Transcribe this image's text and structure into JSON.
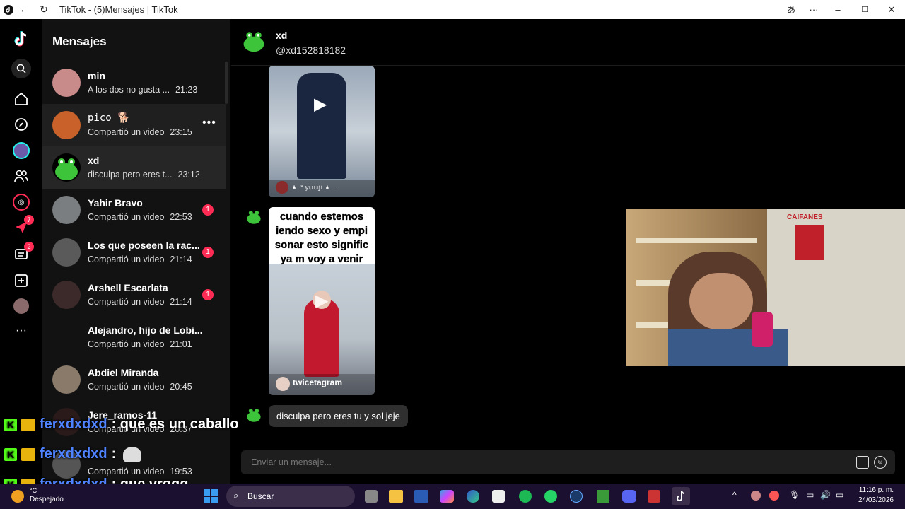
{
  "window": {
    "title": "TikTok - (5)Mensajes | TikTok"
  },
  "sidebar_rail": {
    "badges": {
      "messages_inbox": "7",
      "messages": "2"
    }
  },
  "conversations": {
    "title": "Mensajes",
    "items": [
      {
        "name": "min",
        "preview": "A los dos no gusta ...",
        "time": "21:23",
        "unread": ""
      },
      {
        "name": "𝚙𝚒𝚌𝚘 🐕",
        "preview": "Compartió un video",
        "time": "23:15",
        "unread": ""
      },
      {
        "name": "xd",
        "preview": "disculpa pero eres t...",
        "time": "23:12",
        "unread": ""
      },
      {
        "name": "Yahir Bravo",
        "preview": "Compartió un video",
        "time": "22:53",
        "unread": "1"
      },
      {
        "name": "Los que poseen la rac...",
        "preview": "Compartió un video",
        "time": "21:14",
        "unread": "1"
      },
      {
        "name": "Arshell Escarlata",
        "preview": "Compartió un video",
        "time": "21:14",
        "unread": "1"
      },
      {
        "name": "Alejandro, hijo de Lobi...",
        "preview": "Compartió un video",
        "time": "21:01",
        "unread": ""
      },
      {
        "name": "Abdiel Miranda",
        "preview": "Compartió un video",
        "time": "20:45",
        "unread": ""
      },
      {
        "name": "Jere_ramos-11",
        "preview": "Compartió un video",
        "time": "20:37",
        "unread": ""
      },
      {
        "name": "",
        "preview": "Compartió un video",
        "time": "19:53",
        "unread": ""
      }
    ]
  },
  "chat": {
    "name": "xd",
    "handle": "@xd152818182",
    "video1": {
      "caption": "★. ° 𝕪𝕦𝕦𝕛𝕚 ★. ..."
    },
    "video2": {
      "overlay_text": "cuando estemos\niendo sexo y empi\nsonar esto signific\nya m voy a venir",
      "author": "twicetagram"
    },
    "last_message": "disculpa pero eres tu y sol jeje",
    "input_placeholder": "Enviar un mensaje..."
  },
  "webcam": {
    "sign": "CAIFANES"
  },
  "stream_chat": [
    {
      "user": "ferxdxdxd",
      "message": ": que es un caballo"
    },
    {
      "user": "ferxdxdxd",
      "message": ":"
    },
    {
      "user": "ferxdxdxd",
      "message": ": que vrggg"
    }
  ],
  "taskbar": {
    "weather": "Despejado",
    "temp": "°C",
    "search": "Buscar",
    "time": "11:16 p. m.",
    "date": "24/03/2026"
  },
  "colors": {
    "accent": "#fe2c55",
    "kick": "#53fc18",
    "chat_user": "#4f83ff"
  }
}
